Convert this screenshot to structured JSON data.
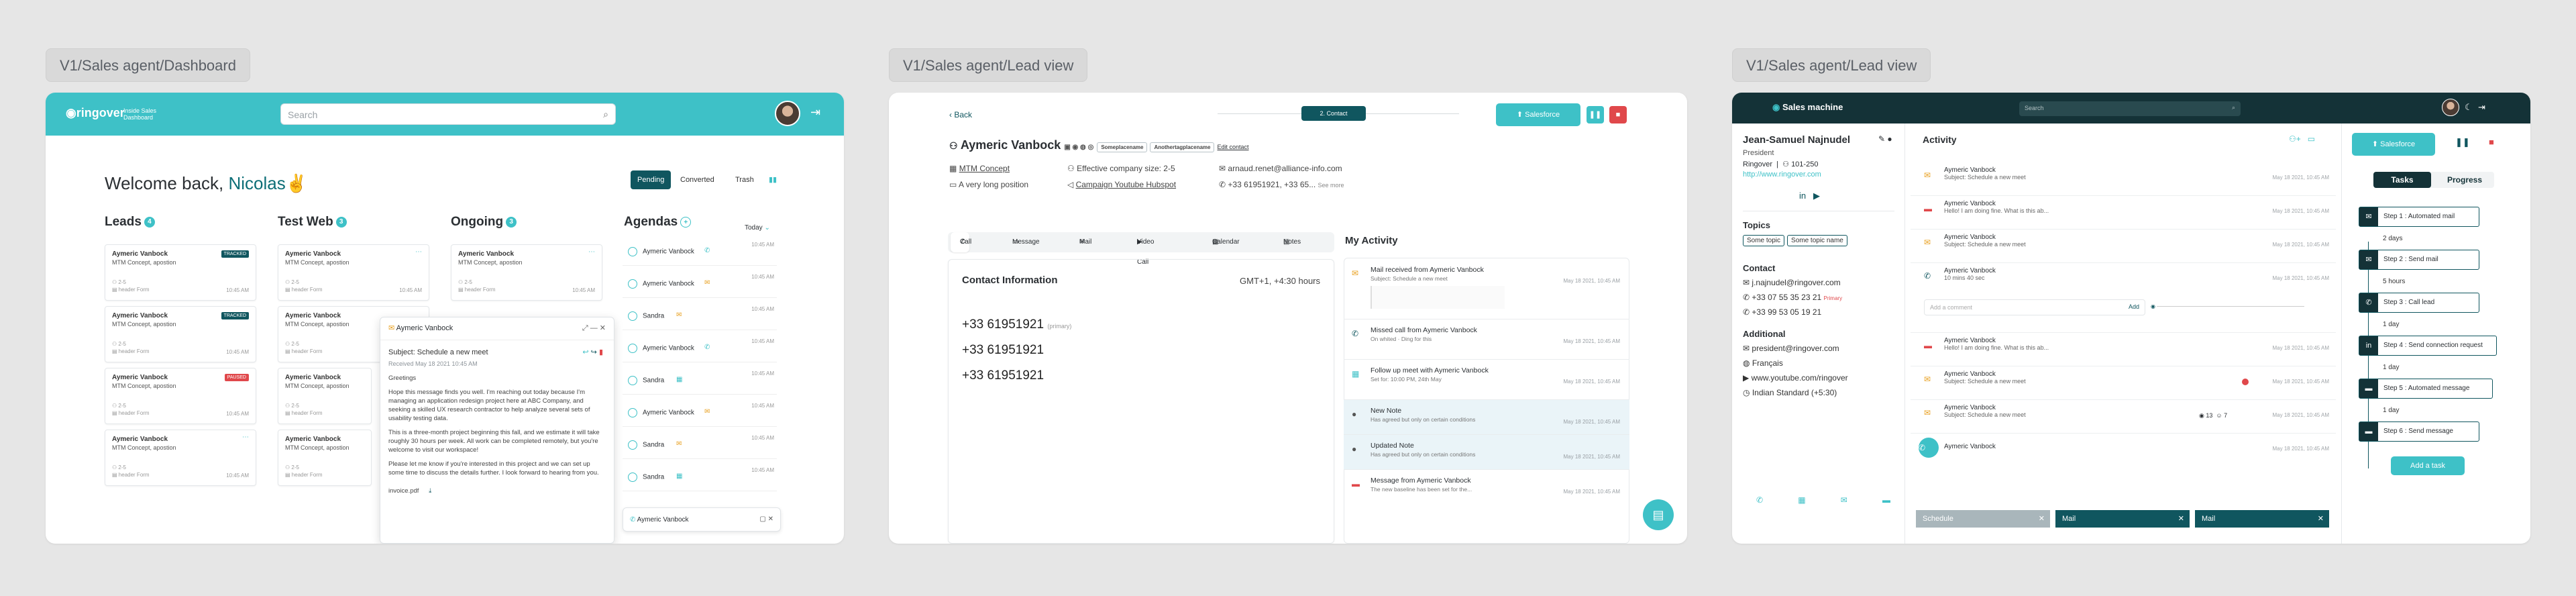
{
  "frames": [
    {
      "label": "V1/Sales agent/Dashboard"
    },
    {
      "label": "V1/Sales agent/Lead view"
    },
    {
      "label": "V1/Sales agent/Lead view"
    }
  ],
  "dashboard": {
    "brand": "ringover",
    "brand_sub": "Inside Sales Dashboard",
    "search_placeholder": "Search",
    "welcome_prefix": "Welcome back, ",
    "welcome_name": "Nicolas✌",
    "filters": [
      "Pending",
      "Converted",
      "Trash"
    ],
    "columns": [
      {
        "title": "Leads",
        "count": "4"
      },
      {
        "title": "Test Web",
        "count": "3"
      },
      {
        "title": "Ongoing",
        "count": "3"
      },
      {
        "title": "Agendas",
        "count": "+"
      }
    ],
    "today_label": "Today",
    "card_name": "Aymeric Vanbock",
    "card_company": "MTM Concept, apostion",
    "card_meta": "2-5",
    "card_form": "header Form",
    "card_time": "10:45 AM",
    "card_tags": [
      "TRACKED",
      "TRACKED",
      "PAUSED",
      ""
    ],
    "agenda_items": [
      "Aymeric Vanbock",
      "Aymeric Vanbock",
      "Sandra",
      "Aymeric Vanbock",
      "Sandra",
      "Aymeric Vanbock",
      "Sandra",
      "Sandra"
    ],
    "agenda_time": "10:45 AM",
    "popup": {
      "name": "Aymeric Vanbock",
      "subject": "Subject: Schedule a new meet",
      "received": "Received May 18 2021 10:45 AM",
      "body": [
        "Greetings",
        "Hope this message finds you well. I'm reaching out today because I'm managing an application redesign project here at ABC Company, and seeking a skilled UX research contractor to help analyze several sets of usability testing data.",
        "This is a three-month project beginning this fall, and we estimate it will take roughly 30 hours per week. All work can be completed remotely, but you're welcome to visit our workspace!",
        "Please let me know if you're interested in this project and we can set up some time to discuss the details further. I look forward to hearing from you."
      ],
      "attachment": "invoice.pdf"
    },
    "minicall_name": "Aymeric Vanbock"
  },
  "leadview": {
    "back": "Back",
    "timeline_pill": "2. Contact",
    "salesforce": "Salesforce",
    "name": "Aymeric Vanbock",
    "chips": [
      "Someplacename",
      "Anothertagplacename"
    ],
    "edit_contact": "Edit contact",
    "company": "MTM Concept",
    "company_size": "Effective company size: 2-5",
    "email": "arnaud.renet@alliance-info.com",
    "position": "A very long position",
    "campaign": "Campaign Youtube Hubspot",
    "phones_short": "+33 61951921, +33 65...",
    "see_more": "See more",
    "tabs": [
      "Call",
      "Message",
      "Mail",
      "Video Call",
      "Calendar",
      "Notes"
    ],
    "contact_info_title": "Contact Information",
    "timezone": "GMT+1, +4:30 hours",
    "phones": [
      "+33 61951921",
      "+33 61951921",
      "+33 61951921"
    ],
    "primary_label": "(primary)",
    "activity_title": "My Activity",
    "activity": [
      {
        "title": "Mail received from Aymeric Vanbock",
        "sub": "Subject: Schedule a new meet",
        "time": "May 18 2021, 10:45 AM"
      },
      {
        "title": "Missed call from Aymeric Vanbock",
        "sub": "On whited · Ding for this",
        "time": "May 18 2021, 10:45 AM"
      },
      {
        "title": "Follow up meet with Aymeric Vanbock",
        "sub": "Set for: 10:00 PM, 24th May",
        "time": "May 18 2021, 10:45 AM"
      },
      {
        "title": "New Note",
        "sub": "Has agreed but only on certain conditions",
        "time": "May 18 2021, 10:45 AM"
      },
      {
        "title": "Updated Note",
        "sub": "Has agreed but only on certain conditions",
        "time": "May 18 2021, 10:45 AM"
      },
      {
        "title": "Message from Aymeric Vanbock",
        "sub": "The new baseline has been set for the...",
        "time": "May 18 2021, 10:45 AM"
      }
    ]
  },
  "machine": {
    "brand": "Sales machine",
    "search_placeholder": "Search",
    "name": "Jean-Samuel Najnudel",
    "role": "President",
    "company": "Ringover",
    "size": "101-250",
    "site": "http://www.ringover.com",
    "topics_title": "Topics",
    "topics": [
      "Some topic",
      "Some topic name"
    ],
    "contact_title": "Contact",
    "contact_email": "j.najnudel@ringover.com",
    "contact_phone1": "+33 07 55 35 23 21",
    "primary": "Primary",
    "contact_phone2": "+33 99 53 05 19 21",
    "additional_title": "Additional",
    "additional": [
      "president@ringover.com",
      "Français",
      "www.youtube.com/ringover",
      "Indian Standard (+5:30)"
    ],
    "activity_title": "Activity",
    "feed": [
      {
        "name": "Aymeric Vanbock",
        "sub": "Subject: Schedule a new meet"
      },
      {
        "name": "Aymeric Vanbock",
        "sub": "Hello! I am doing fine. What is this ab..."
      },
      {
        "name": "Aymeric Vanbock",
        "sub": "Subject: Schedule a new meet"
      },
      {
        "name": "Aymeric Vanbock",
        "sub": "10 mins 40 sec"
      },
      {
        "name": "Aymeric Vanbock",
        "sub": "Hello! I am doing fine. What is this ab..."
      },
      {
        "name": "Aymeric Vanbock",
        "sub": "Subject: Schedule a new meet"
      },
      {
        "name": "Aymeric Vanbock",
        "sub": "Subject: Schedule a new meet"
      },
      {
        "name": "Aymeric Vanbock",
        "sub": ""
      }
    ],
    "feed_time": "May 18 2021, 10:45 AM",
    "comment_placeholder": "Add a comment",
    "add_label": "Add",
    "views": "13",
    "reactions": "7",
    "bottom_tags": [
      "Schedule",
      "Mail",
      "Mail"
    ],
    "salesforce": "Salesforce",
    "tabs": [
      "Tasks",
      "Progress"
    ],
    "steps": [
      "Step 1 : Automated mail",
      "Step 2 : Send mail",
      "Step 3 : Call lead",
      "Step 4 : Send connection request",
      "Step 5 : Automated message",
      "Step 6 : Send message"
    ],
    "gaps": [
      "2 days",
      "5 hours",
      "1 day",
      "1 day",
      "1 day"
    ],
    "add_task": "Add a task"
  }
}
